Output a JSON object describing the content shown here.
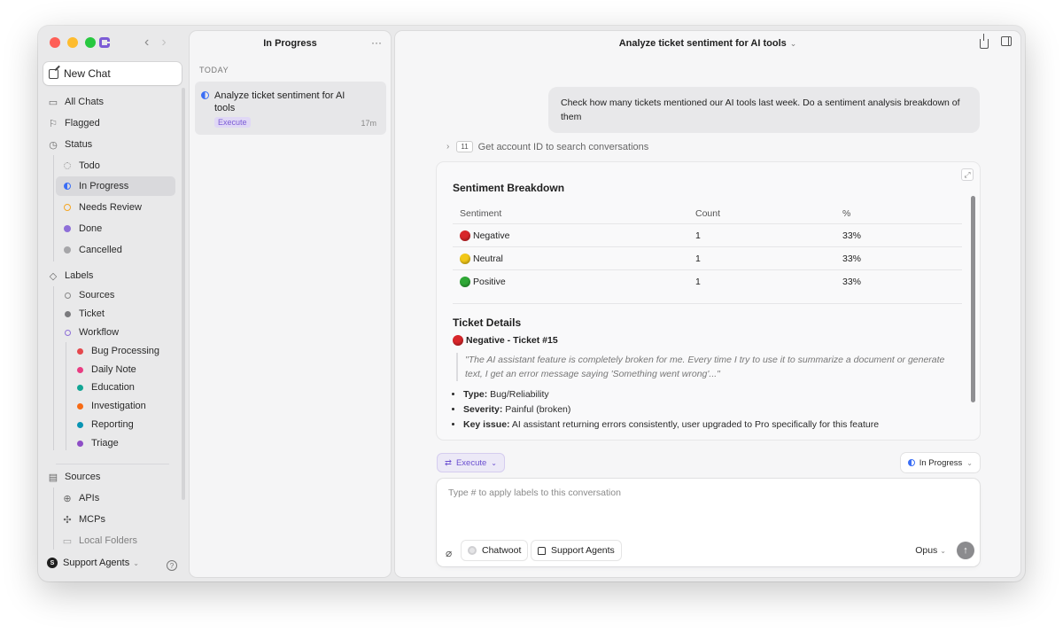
{
  "sidebar": {
    "new_chat": "New Chat",
    "all_chats": "All Chats",
    "flagged": "Flagged",
    "status_header": "Status",
    "status_items": [
      "Todo",
      "In Progress",
      "Needs Review",
      "Done",
      "Cancelled"
    ],
    "labels_header": "Labels",
    "label_items": [
      "Sources",
      "Ticket",
      "Workflow"
    ],
    "workflow_items": [
      "Bug Processing",
      "Daily Note",
      "Education",
      "Investigation",
      "Reporting",
      "Triage"
    ],
    "workflow_colors": [
      "#e5484d",
      "#e93d82",
      "#12a594",
      "#f76b15",
      "#0894b3",
      "#8e4ec6"
    ],
    "sources_header": "Sources",
    "source_items": [
      "APIs",
      "MCPs",
      "Local Folders"
    ],
    "workspace": "Support Agents",
    "workspace_initial": "S",
    "help": "?"
  },
  "list": {
    "title": "In Progress",
    "menu": "···",
    "group": "TODAY",
    "item": {
      "title": "Analyze ticket sentiment for AI tools",
      "badge": "Execute",
      "time": "17m"
    }
  },
  "main": {
    "title": "Analyze ticket sentiment for AI tools",
    "user_message": "Check how many tickets mentioned our AI tools last week. Do a sentiment analysis breakdown of them",
    "tool_count": "11",
    "tool_label": "Get account ID to search conversations",
    "breakdown_title": "Sentiment Breakdown",
    "table": {
      "headers": [
        "Sentiment",
        "Count",
        "%"
      ],
      "rows": [
        {
          "sentiment": "Negative",
          "count": "1",
          "pct": "33%"
        },
        {
          "sentiment": "Neutral",
          "count": "1",
          "pct": "33%"
        },
        {
          "sentiment": "Positive",
          "count": "1",
          "pct": "33%"
        }
      ]
    },
    "details_title": "Ticket Details",
    "ticket_title": "Negative - Ticket #15",
    "quote": "\"The AI assistant feature is completely broken for me. Every time I try to use it to summarize a document or generate text, I get an error message saying 'Something went wrong'...\"",
    "bullets": [
      {
        "label": "Type:",
        "value": " Bug/Reliability"
      },
      {
        "label": "Severity:",
        "value": " Painful (broken)"
      },
      {
        "label": "Key issue:",
        "value": " AI assistant returning errors consistently, user upgraded to Pro specifically for this feature"
      }
    ]
  },
  "composer": {
    "mode": "Execute",
    "status": "In Progress",
    "placeholder": "Type # to apply labels to this conversation",
    "source_chip": "Chatwoot",
    "workspace_chip": "Support Agents",
    "model": "Opus"
  }
}
